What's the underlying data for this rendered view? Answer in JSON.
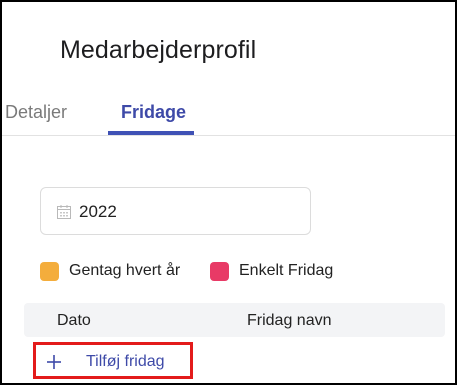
{
  "header": {
    "title": "Medarbejderprofil"
  },
  "tabs": [
    {
      "label": "Detaljer",
      "active": false
    },
    {
      "label": "Fridage",
      "active": true
    }
  ],
  "year_field": {
    "value": "2022",
    "icon": "calendar-icon"
  },
  "legend": [
    {
      "label": "Gentag hvert år",
      "color": "#f4ad3c"
    },
    {
      "label": "Enkelt Fridag",
      "color": "#e83a66"
    }
  ],
  "table": {
    "columns": [
      "Dato",
      "Fridag navn"
    ]
  },
  "add_button": {
    "label": "Tilføj fridag",
    "icon": "plus-icon"
  },
  "colors": {
    "accent": "#3f51b5",
    "highlight_box": "#e31b1b"
  }
}
